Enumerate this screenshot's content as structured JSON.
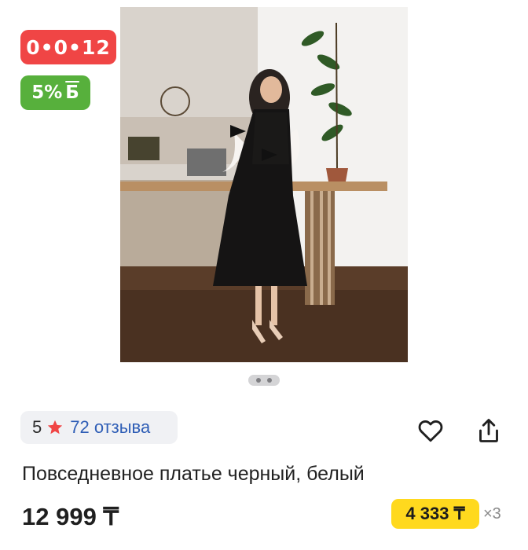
{
  "badges": {
    "timer": "0•0•12",
    "bonus_percent": "5%",
    "bonus_symbol": "Б"
  },
  "gallery": {
    "image_alt": "woman-in-black-dress-photo",
    "slides_indicator": 2
  },
  "rating": {
    "value": "5",
    "reviews_label": "72 отзыва"
  },
  "product": {
    "title": "Повседневное платье черный, белый",
    "price": "12 999 ₸",
    "installment_price": "4 333 ₸",
    "installment_multiplier": "×3"
  },
  "icons": {
    "star": "star-icon",
    "favorite": "heart-icon",
    "share": "share-icon"
  },
  "colors": {
    "timer_badge": "#f04545",
    "bonus_badge": "#57b03c",
    "star": "#f04545",
    "reviews_link": "#2f5eb6",
    "installment_badge": "#ffd91e"
  }
}
